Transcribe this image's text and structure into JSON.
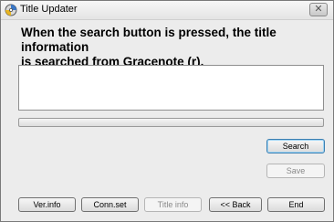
{
  "window": {
    "title": "Title Updater",
    "close_label": "✕"
  },
  "heading": {
    "line1": "When the search button is pressed, the title information",
    "line2": "is searched from Gracenote (r)."
  },
  "result_text": "",
  "progress": {
    "value": 0
  },
  "buttons": {
    "search": "Search",
    "save": "Save",
    "ver_info": "Ver.info",
    "conn_set": "Conn.set",
    "title_info": "Title info",
    "back": "<< Back",
    "end": "End"
  },
  "icons": {
    "app": "disc-icon",
    "close": "close-icon"
  }
}
